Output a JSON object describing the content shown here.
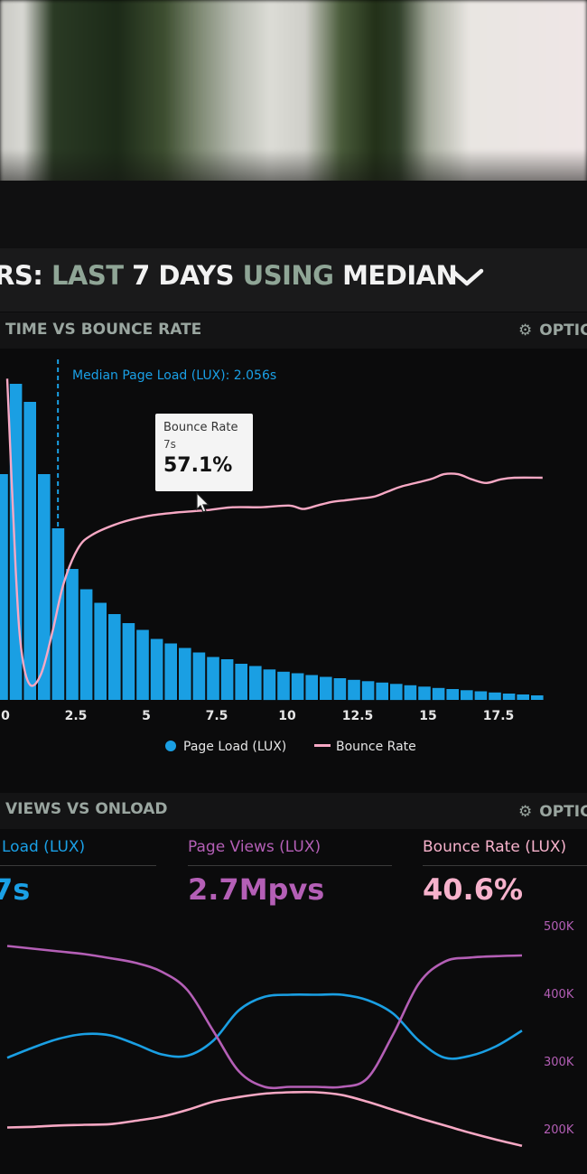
{
  "header": {
    "title_parts": [
      "RS:",
      "LAST",
      "7 DAYS",
      "USING",
      "MEDIAN"
    ]
  },
  "panels": {
    "top": {
      "title": "TIME VS BOUNCE RATE",
      "options_label": "OPTIC"
    },
    "bottom": {
      "title": "VIEWS VS ONLOAD",
      "options_label": "OPTIC"
    }
  },
  "icons": {
    "options": "gear-icon",
    "dropdown": "chevron-down-icon"
  },
  "colors": {
    "blue": "#1a9fe3",
    "pink": "#f7a8c4",
    "purple": "#b45fb6",
    "accent_text": "#8fa596"
  },
  "chart_data": [
    {
      "type": "bar",
      "xlabel": "",
      "ylabel": "",
      "x_ticks": [
        "0",
        "2.5",
        "5",
        "7.5",
        "10",
        "12.5",
        "15",
        "17.5"
      ],
      "xlim": [
        0,
        19.5
      ],
      "annotation": "Median Page Load (LUX): 2.056s",
      "median_x": 2.056,
      "tooltip": {
        "title": "Bounce Rate",
        "x_label": "7s",
        "value": "57.1%"
      },
      "legend": [
        "Page Load (LUX)",
        "Bounce Rate"
      ],
      "legend_placement": "bottom",
      "series": [
        {
          "name": "Page Load (LUX)",
          "type": "bar",
          "x": [
            0,
            0.5,
            1,
            1.5,
            2,
            2.5,
            3,
            3.5,
            4,
            4.5,
            5,
            5.5,
            6,
            6.5,
            7,
            7.5,
            8,
            8.5,
            9,
            9.5,
            10,
            10.5,
            11,
            11.5,
            12,
            12.5,
            13,
            13.5,
            14,
            14.5,
            15,
            15.5,
            16,
            16.5,
            17,
            17.5,
            18,
            18.5,
            19
          ],
          "values": [
            100,
            140,
            132,
            100,
            76,
            58,
            49,
            43,
            38,
            34,
            31,
            27,
            25,
            23,
            21,
            19,
            18,
            16,
            15,
            13.5,
            12.5,
            11.8,
            11,
            10.2,
            9.6,
            8.9,
            8.3,
            7.7,
            7.1,
            6.5,
            5.9,
            5.3,
            4.8,
            4.3,
            3.8,
            3.3,
            2.8,
            2.4,
            2
          ]
        },
        {
          "name": "Bounce Rate",
          "type": "line",
          "x": [
            0,
            0.3,
            0.5,
            0.8,
            1.2,
            1.6,
            2,
            2.5,
            3,
            4,
            5,
            6,
            7,
            8,
            9,
            10,
            10.5,
            11,
            11.5,
            12,
            12.5,
            13,
            13.5,
            14,
            15,
            15.5,
            16,
            16.5,
            17,
            17.5,
            18,
            19
          ],
          "values": [
            95,
            40,
            17,
            7,
            10,
            22,
            36,
            46,
            50,
            53.5,
            55.5,
            56.5,
            57.1,
            58,
            58,
            58.5,
            57.5,
            58.5,
            59.5,
            60,
            60.5,
            61,
            62.5,
            64,
            66,
            67.5,
            67.5,
            66,
            65,
            66,
            66.5,
            66.5
          ]
        }
      ]
    },
    {
      "type": "line",
      "kpis": [
        {
          "label": "Load (LUX)",
          "value": "7s"
        },
        {
          "label": "Page Views (LUX)",
          "value": "2.7Mpvs"
        },
        {
          "label": "Bounce Rate (LUX)",
          "value": "40.6%"
        }
      ],
      "y_ticks": [
        "500K",
        "400K",
        "300K",
        "200K"
      ],
      "ylim": [
        180000,
        520000
      ],
      "x": [
        0,
        1,
        2,
        3,
        4,
        5,
        6,
        7,
        8,
        9,
        10,
        11,
        12,
        13,
        14,
        15,
        16,
        17,
        18,
        19,
        20
      ],
      "series": [
        {
          "name": "Page Load (LUX)",
          "values": [
            305000,
            320000,
            333000,
            340000,
            338000,
            325000,
            310000,
            308000,
            330000,
            375000,
            395000,
            398000,
            398000,
            398000,
            390000,
            370000,
            330000,
            305000,
            308000,
            322000,
            345000
          ]
        },
        {
          "name": "Page Views (LUX)",
          "values": [
            470000,
            466000,
            462000,
            458000,
            452000,
            445000,
            432000,
            405000,
            345000,
            285000,
            262000,
            262000,
            262000,
            262000,
            275000,
            340000,
            415000,
            447000,
            453000,
            455000,
            456000
          ]
        },
        {
          "name": "Bounce Rate (LUX)",
          "values": [
            202000,
            203000,
            205000,
            206000,
            207000,
            212000,
            218000,
            228000,
            240000,
            247000,
            252000,
            254000,
            254000,
            250000,
            240000,
            228000,
            216000,
            205000,
            194000,
            184000,
            175000
          ]
        }
      ]
    }
  ]
}
